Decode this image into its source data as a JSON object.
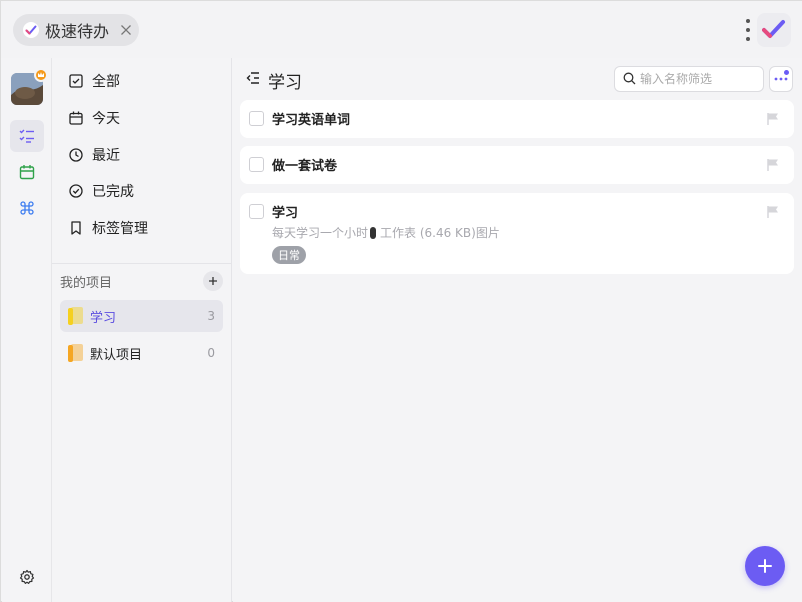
{
  "window": {
    "tab_label": "极速待办"
  },
  "sidebar": {
    "nav": [
      {
        "label": "全部",
        "icon": "checkbox-icon"
      },
      {
        "label": "今天",
        "icon": "calendar-icon"
      },
      {
        "label": "最近",
        "icon": "clock-icon"
      },
      {
        "label": "已完成",
        "icon": "check-circle-icon"
      },
      {
        "label": "标签管理",
        "icon": "bookmark-icon"
      }
    ],
    "projects_heading": "我的项目",
    "projects": [
      {
        "name": "学习",
        "count": "3",
        "color": "#f5d020",
        "active": true
      },
      {
        "name": "默认项目",
        "count": "0",
        "color": "#f5a623",
        "active": false
      }
    ]
  },
  "main": {
    "title": "学习",
    "search_placeholder": "输入名称筛选",
    "tasks": [
      {
        "title": "学习英语单词"
      },
      {
        "title": "做一套试卷"
      },
      {
        "title": "学习",
        "desc_before": "每天学习一个小时",
        "desc_after": "工作表 (6.46 KB)图片",
        "tag": "日常"
      }
    ]
  },
  "colors": {
    "accent": "#6c5cf3",
    "active_text": "#5b4de0"
  }
}
